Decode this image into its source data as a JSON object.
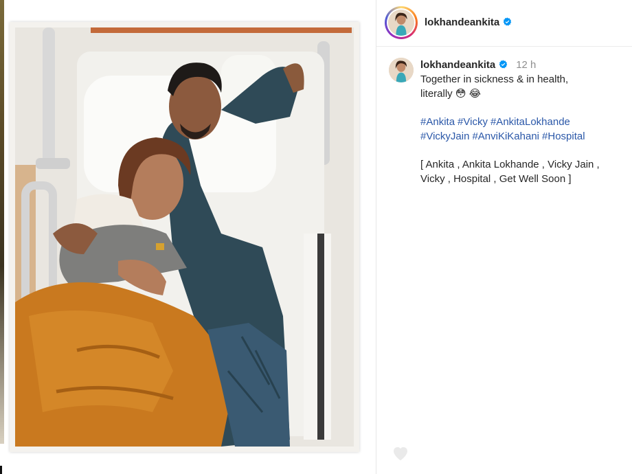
{
  "post": {
    "username": "lokhandeankita",
    "verified": true,
    "time": "12 h",
    "caption_line1": "Together in sickness & in health,",
    "caption_line2": "literally 😳 😂",
    "hashtags": [
      "#Ankita",
      "#Vicky",
      "#AnkitaLokhande",
      "#VickyJain",
      "#AnviKiKahani",
      "#Hospital"
    ],
    "keywords_line1": "[ Ankita , Ankita Lokhande , Vicky Jain ,",
    "keywords_line2": "Vicky , Hospital , Get Well Soon ]"
  },
  "icons": {
    "verified": "verified-badge-icon",
    "more": "more-options-icon",
    "heart": "heart-icon"
  },
  "colors": {
    "accent_link": "#2a57a8",
    "verified_blue": "#0095f6",
    "muted": "#8e8e8e"
  }
}
